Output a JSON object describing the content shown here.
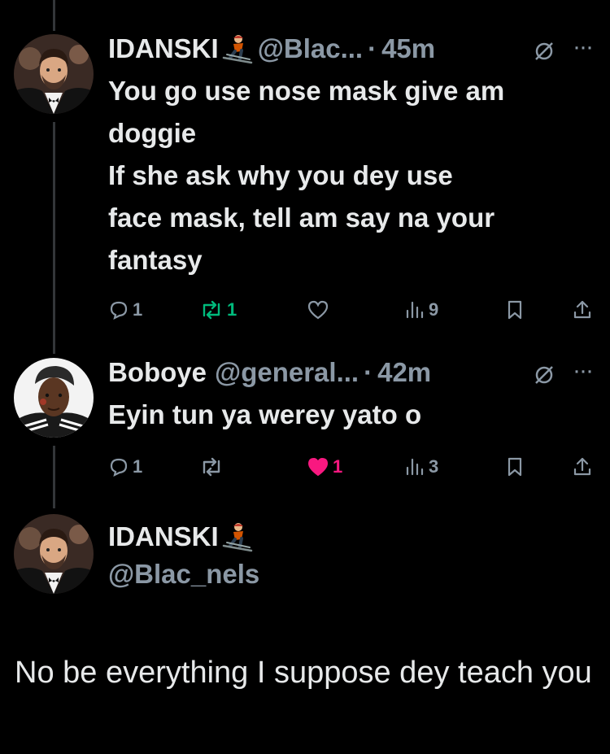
{
  "theme": {
    "background": "#000000",
    "text_primary": "#e7e9ea",
    "text_secondary": "#8b98a5",
    "retweet_active": "#00ba7c",
    "like_active": "#f91880",
    "thread_line": "#333639"
  },
  "tweets": [
    {
      "name": "IDANSKI",
      "name_emoji": "skier-emoji",
      "handle": "@Blac...",
      "separator": "·",
      "time": "45m",
      "text": "You go use nose mask give am\ndoggie\nIf she ask why you dey use\nface mask, tell am say na your\nfantasy",
      "actions": {
        "replies": "1",
        "reposts": "1",
        "reposted": true,
        "likes": "",
        "liked": false,
        "views": "9"
      }
    },
    {
      "name": "Boboye",
      "name_emoji": "",
      "handle": "@general...",
      "separator": "·",
      "time": "42m",
      "text": "Eyin tun ya werey yato o",
      "actions": {
        "replies": "1",
        "reposts": "",
        "reposted": false,
        "likes": "1",
        "liked": true,
        "views": "3"
      }
    }
  ],
  "quoted_profile": {
    "name": "IDANSKI",
    "name_emoji": "skier-emoji",
    "handle": "@Blac_nels"
  },
  "main_tweet": {
    "text": "No be everything I suppose dey teach you"
  }
}
